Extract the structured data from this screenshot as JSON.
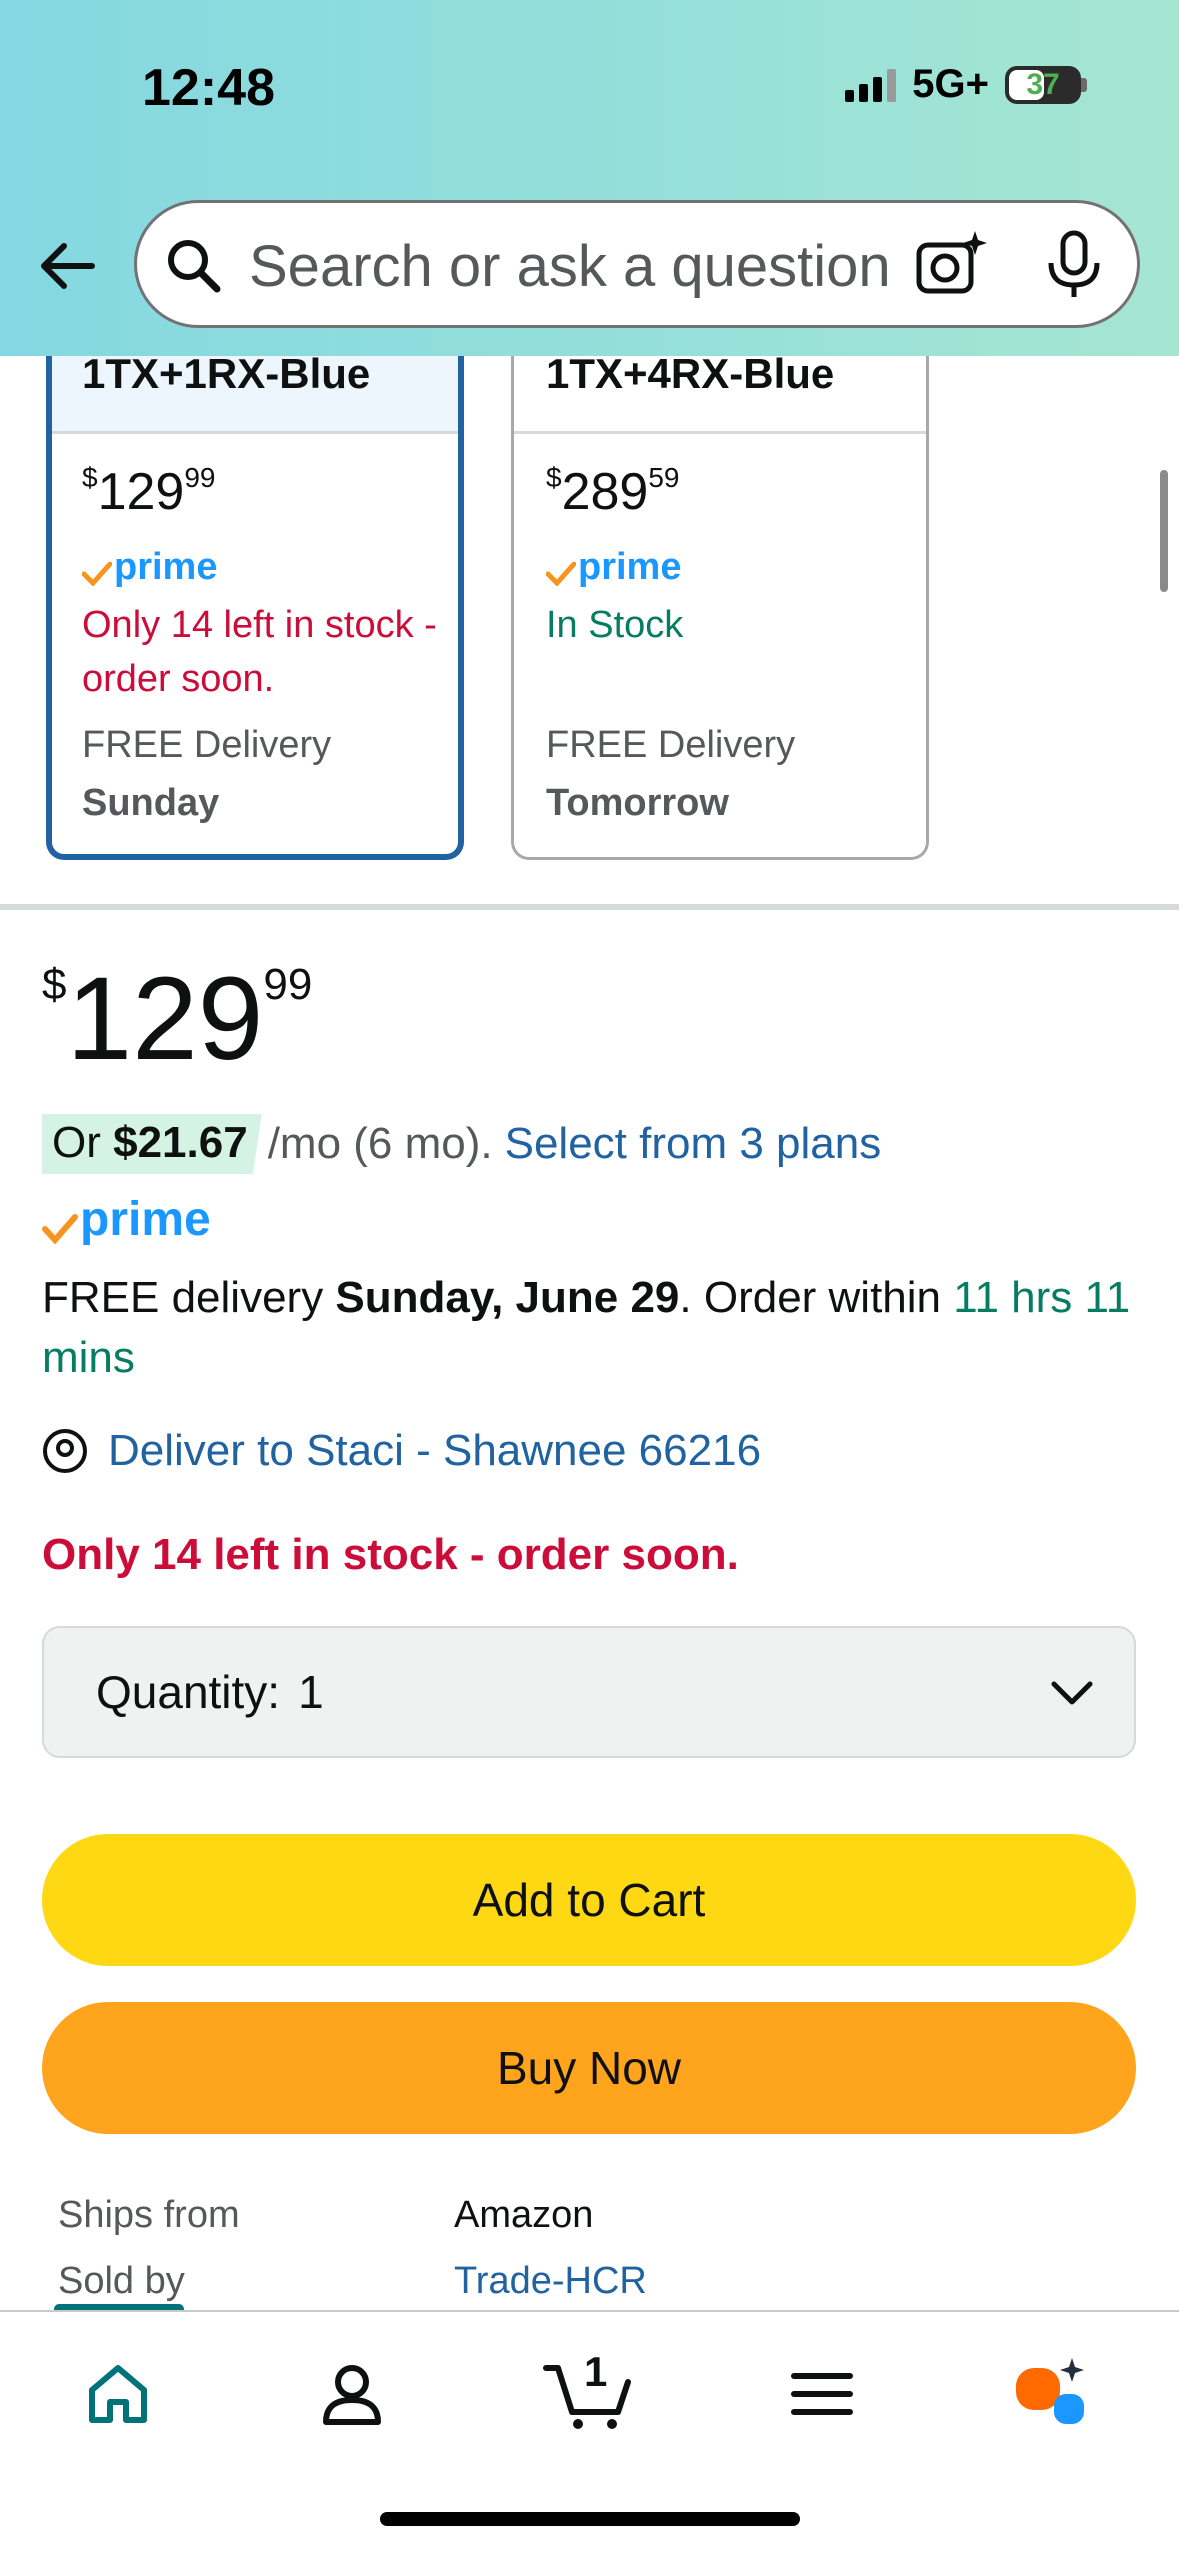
{
  "status_bar": {
    "time": "12:48",
    "network": "5G+",
    "battery": "37"
  },
  "search": {
    "placeholder": "Search or ask a question"
  },
  "variants": [
    {
      "name": "1TX+1RX-Blue",
      "price_whole": "129",
      "price_fraction": "99",
      "currency": "$",
      "prime": "prime",
      "stock": "Only 14 left in stock - order soon.",
      "delivery_label": "FREE Delivery",
      "delivery_day": "Sunday",
      "selected": true
    },
    {
      "name": "1TX+4RX-Blue",
      "price_whole": "289",
      "price_fraction": "59",
      "currency": "$",
      "prime": "prime",
      "stock": "In Stock",
      "delivery_label": "FREE Delivery",
      "delivery_day": "Tomorrow",
      "selected": false
    }
  ],
  "buybox": {
    "currency": "$",
    "price_whole": "129",
    "price_fraction": "99",
    "installment_prefix": "Or ",
    "installment_amount": "$21.67",
    "installment_term": "/mo (6 mo).",
    "installment_link": "Select from 3 plans",
    "prime": "prime",
    "delivery_prefix": "FREE delivery ",
    "delivery_date": "Sunday, June 29",
    "delivery_mid": ". Order within ",
    "delivery_countdown": "11 hrs 11 mins",
    "deliver_to": "Deliver to Staci - Shawnee 66216",
    "stock_alert": "Only 14 left in stock - order soon.",
    "quantity_label": "Quantity:",
    "quantity_value": "1",
    "add_to_cart": "Add to Cart",
    "buy_now": "Buy Now",
    "ships_from_label": "Ships from",
    "ships_from_value": "Amazon",
    "sold_by_label": "Sold by",
    "sold_by_value": "Trade-HCR"
  },
  "bottom_nav": {
    "cart_count": "1",
    "items": [
      "home-icon",
      "account-icon",
      "cart-icon",
      "menu-icon",
      "rufus-icon"
    ]
  },
  "colors": {
    "accent_link": "#2162A1",
    "prime_blue": "#1A98FF",
    "alert_red": "#CC0C39",
    "success_green": "#067D62",
    "add_to_cart": "#FFD814",
    "buy_now": "#FFA41C"
  }
}
